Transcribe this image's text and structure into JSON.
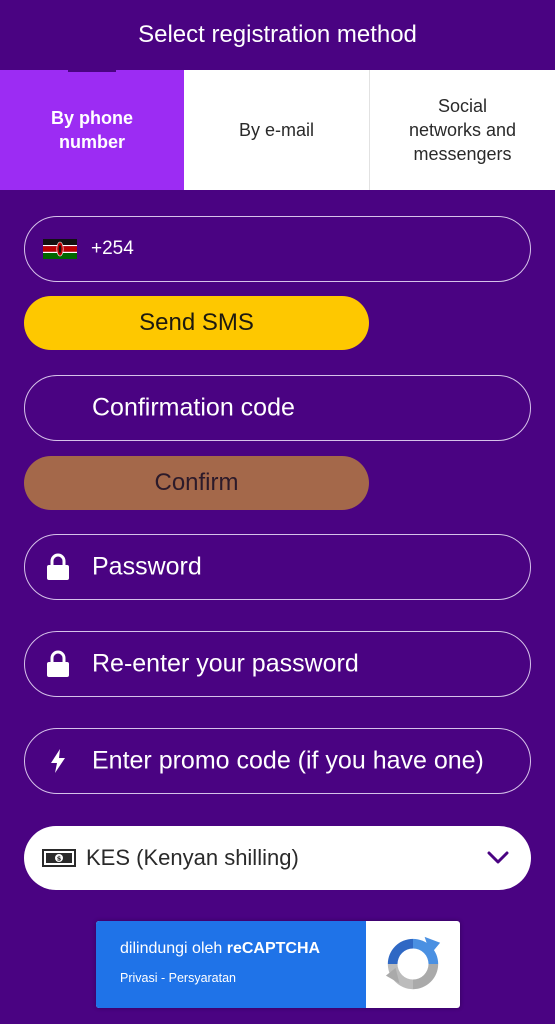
{
  "header": {
    "title": "Select registration method"
  },
  "tabs": [
    {
      "label": "By phone\nnumber",
      "active": true
    },
    {
      "label": "By e-mail",
      "active": false
    },
    {
      "label": "Social\nnetworks and\nmessengers",
      "active": false
    }
  ],
  "phone": {
    "country_code": "+254",
    "flag_icon": "kenya-flag-icon"
  },
  "buttons": {
    "send_sms": "Send SMS",
    "confirm": "Confirm"
  },
  "fields": {
    "confirmation_code": "Confirmation code",
    "password": "Password",
    "reenter_password": "Re-enter your password",
    "promo_code": "Enter promo code (if you have one)"
  },
  "currency": {
    "selected": "KES (Kenyan shilling)",
    "icon": "money-icon"
  },
  "recaptcha": {
    "protected_prefix": "dilindungi oleh ",
    "brand": "reCAPTCHA",
    "links": "Privasi - Persyaratan"
  },
  "colors": {
    "background": "#4a0382",
    "active_tab": "#9c2cf3",
    "send_sms": "#fec800",
    "confirm": "#a4684a",
    "recaptcha_blue": "#1f73e8"
  }
}
